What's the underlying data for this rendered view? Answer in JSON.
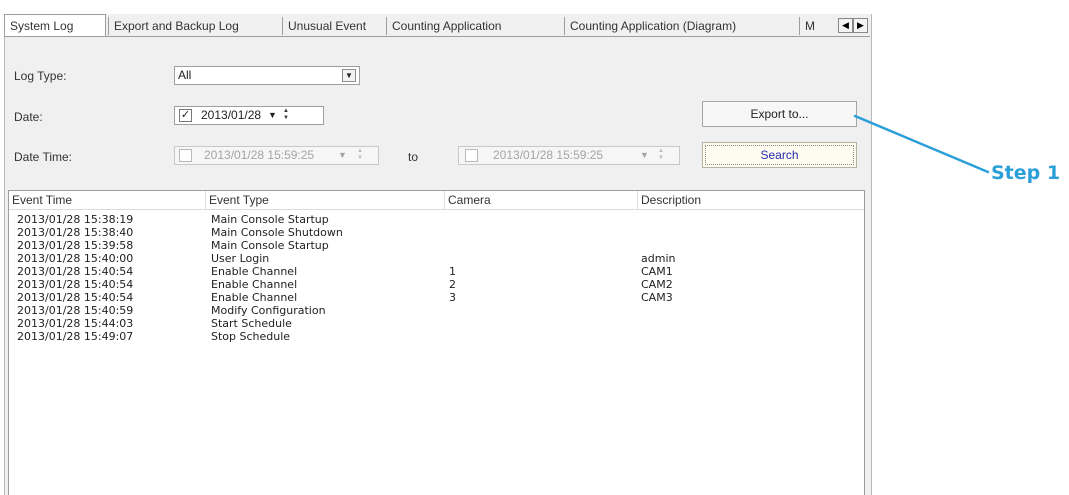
{
  "tabs": [
    {
      "label": "System Log",
      "active": true
    },
    {
      "label": "Export and Backup Log",
      "active": false
    },
    {
      "label": "Unusual Event",
      "active": false
    },
    {
      "label": "Counting Application",
      "active": false
    },
    {
      "label": "Counting Application (Diagram)",
      "active": false
    },
    {
      "label": "M",
      "active": false
    }
  ],
  "form": {
    "log_type_label": "Log Type:",
    "log_type_value": "All",
    "date_label": "Date:",
    "date_checked": true,
    "date_value": "2013/01/28",
    "date_time_label": "Date Time:",
    "date_time_from": "2013/01/28 15:59:25",
    "to_label": "to",
    "date_time_to": "2013/01/28 15:59:25",
    "export_label": "Export to...",
    "search_label": "Search"
  },
  "table": {
    "columns": [
      "Event Time",
      "Event Type",
      "Camera",
      "Description"
    ],
    "rows": [
      [
        "2013/01/28 15:38:19",
        "Main Console Startup",
        "",
        ""
      ],
      [
        "2013/01/28 15:38:40",
        "Main Console Shutdown",
        "",
        ""
      ],
      [
        "2013/01/28 15:39:58",
        "Main Console Startup",
        "",
        ""
      ],
      [
        "2013/01/28 15:40:00",
        "User Login",
        "",
        "admin"
      ],
      [
        "2013/01/28 15:40:54",
        "Enable Channel",
        "1",
        "CAM1"
      ],
      [
        "2013/01/28 15:40:54",
        "Enable Channel",
        "2",
        "CAM2"
      ],
      [
        "2013/01/28 15:40:54",
        "Enable Channel",
        "3",
        "CAM3"
      ],
      [
        "2013/01/28 15:40:59",
        "Modify Configuration",
        "",
        ""
      ],
      [
        "2013/01/28 15:44:03",
        "Start Schedule",
        "",
        ""
      ],
      [
        "2013/01/28 15:49:07",
        "Stop Schedule",
        "",
        ""
      ]
    ]
  },
  "annotation": {
    "step_label": "Step 1",
    "color": "#2a9fd8"
  },
  "icons": {
    "tab_prev": "triangle-left-icon",
    "tab_next": "triangle-right-icon",
    "dropdown": "chevron-down-icon",
    "spin": "spin-updown-icon",
    "check": "checkmark-icon"
  }
}
